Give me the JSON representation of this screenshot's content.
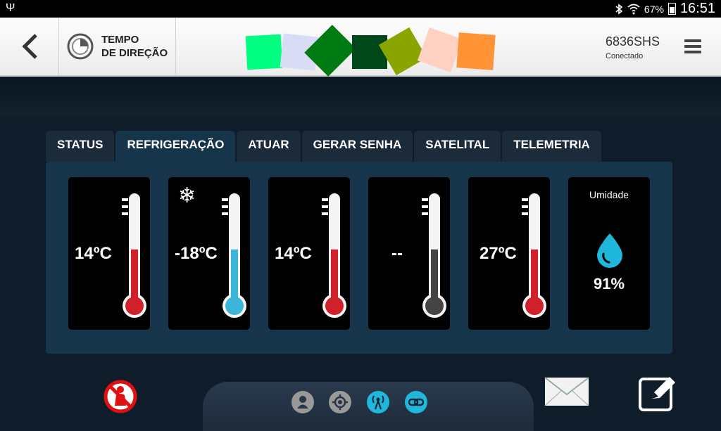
{
  "statusbar": {
    "battery": "67%",
    "time": "16:51",
    "icons": [
      "usb-icon",
      "bluetooth-icon",
      "wifi-icon",
      "battery-icon"
    ]
  },
  "header": {
    "drive_time_label_1": "TEMPO",
    "drive_time_label_2": "DE DIREÇÃO",
    "device_id": "6836SHS",
    "device_status": "Conectado",
    "logo_colors": [
      "#00ff80",
      "#d8dcf4",
      "#007a13",
      "#00471a",
      "#8aa400",
      "#ffd1c0",
      "#ff9436"
    ]
  },
  "tabs": [
    {
      "label": "STATUS",
      "active": false
    },
    {
      "label": "REFRIGERAÇÃO",
      "active": true
    },
    {
      "label": "ATUAR",
      "active": false
    },
    {
      "label": "GERAR SENHA",
      "active": false
    },
    {
      "label": "SATELITAL",
      "active": false
    },
    {
      "label": "TELEMETRIA",
      "active": false
    }
  ],
  "sensors": [
    {
      "value": "14ºC",
      "fill": 0.45,
      "color": "#d0202a",
      "icon": "none"
    },
    {
      "value": "-18ºC",
      "fill": 0.45,
      "color": "#3cb6d8",
      "icon": "snowflake-icon"
    },
    {
      "value": "14ºC",
      "fill": 0.45,
      "color": "#d0202a",
      "icon": "none"
    },
    {
      "value": "--",
      "fill": 0.45,
      "color": "#444444",
      "icon": "none"
    },
    {
      "value": "27ºC",
      "fill": 0.45,
      "color": "#d0202a",
      "icon": "none"
    }
  ],
  "humidity": {
    "label": "Umidade",
    "value": "91%"
  },
  "footer": {
    "nav_icons": [
      "person-icon",
      "location-icon",
      "antenna-icon",
      "link-icon"
    ]
  }
}
